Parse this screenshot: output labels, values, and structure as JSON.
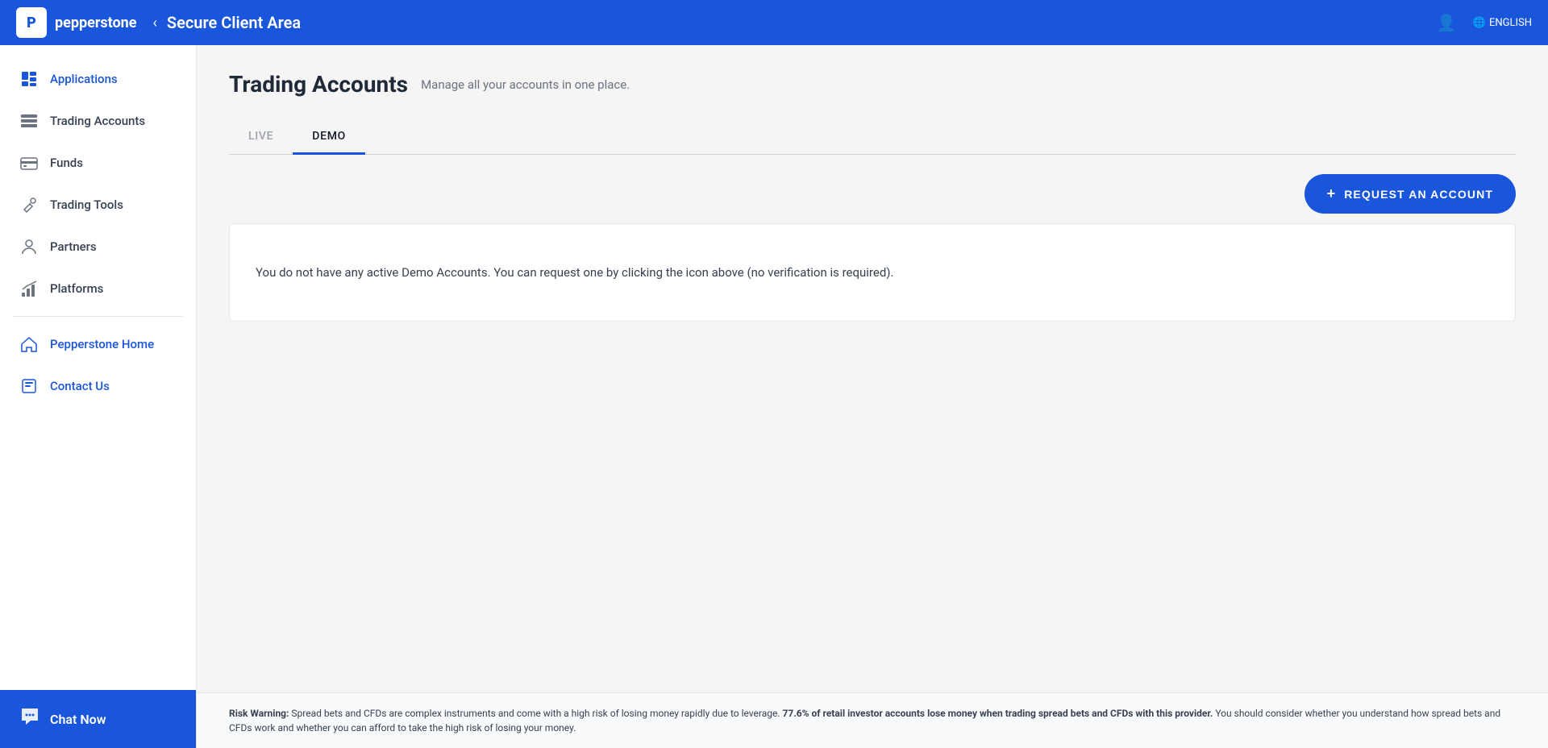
{
  "header": {
    "logo_letter": "P",
    "logo_name": "pepperstone",
    "back_icon": "‹",
    "title": "Secure Client Area",
    "user_icon": "👤",
    "globe_icon": "🌐",
    "language": "ENGLISH"
  },
  "sidebar": {
    "items": [
      {
        "id": "applications",
        "label": "Applications",
        "icon": "📄",
        "active": true,
        "blue": true
      },
      {
        "id": "trading-accounts",
        "label": "Trading Accounts",
        "icon": "⊞",
        "active": false,
        "blue": false
      },
      {
        "id": "funds",
        "label": "Funds",
        "icon": "💳",
        "active": false,
        "blue": false
      },
      {
        "id": "trading-tools",
        "label": "Trading Tools",
        "icon": "🔑",
        "active": false,
        "blue": false
      },
      {
        "id": "partners",
        "label": "Partners",
        "icon": "👤",
        "active": false,
        "blue": false
      },
      {
        "id": "platforms",
        "label": "Platforms",
        "icon": "📊",
        "active": false,
        "blue": false
      }
    ],
    "external_items": [
      {
        "id": "pepperstone-home",
        "label": "Pepperstone Home",
        "icon": "🏠",
        "blue": true
      },
      {
        "id": "contact-us",
        "label": "Contact Us",
        "icon": "📱",
        "blue": true
      }
    ],
    "chat_now": "Chat Now"
  },
  "main": {
    "page_title": "Trading Accounts",
    "page_subtitle": "Manage all your accounts in one place.",
    "tabs": [
      {
        "id": "live",
        "label": "LIVE",
        "active": false
      },
      {
        "id": "demo",
        "label": "DEMO",
        "active": true
      }
    ],
    "request_button": "REQUEST AN ACCOUNT",
    "empty_message": "You do not have any active Demo Accounts. You can request one by clicking the icon above (no verification is required)."
  },
  "risk_warning": {
    "prefix": "Risk Warning:",
    "text": " Spread bets and CFDs are complex instruments and come with a high risk of losing money rapidly due to leverage. ",
    "highlight": "77.6% of retail investor accounts lose money when trading spread bets and CFDs with this provider.",
    "suffix": " You should consider whether you understand how spread bets and CFDs work and whether you can afford to take the high risk of losing your money."
  }
}
